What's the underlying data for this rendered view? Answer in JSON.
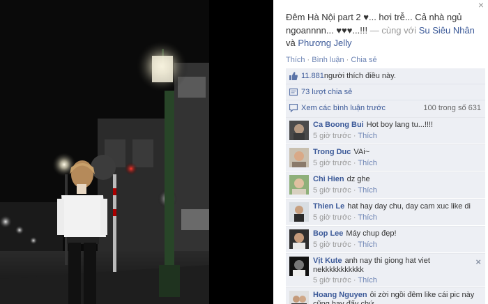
{
  "caption": {
    "text_main": "Đêm Hà Nội part 2 ♥... hơi trễ... Cả nhà ngủ ngoannnn... ♥♥♥...!!!",
    "with_text": " — cùng với ",
    "person1": "Su Siêu Nhân",
    "and_text": " và ",
    "person2": "Phương Jelly"
  },
  "actions": {
    "like": "Thích",
    "comment": "Bình luận",
    "share": "Chia sẻ"
  },
  "likes": {
    "count": "11.881",
    "text": " người thích điều này."
  },
  "shares": {
    "text": "73 lượt chia sẻ"
  },
  "view_comments": {
    "text": "Xem các bình luận trước",
    "count": "100 trong số 631"
  },
  "close_label": "×",
  "comments": [
    {
      "name": "Ca Boong Bui",
      "text": "Hot boy lang tu...!!!!",
      "time": "5 giờ trước",
      "like": "Thích"
    },
    {
      "name": "Trong Duc",
      "text": "VAi~",
      "time": "5 giờ trước",
      "like": "Thích"
    },
    {
      "name": "Chi Hien",
      "text": "dz ghe",
      "time": "5 giờ trước",
      "like": "Thích"
    },
    {
      "name": "Thien Le",
      "text": "hat hay day chu, day cam xuc like di",
      "time": "5 giờ trước",
      "like": "Thích"
    },
    {
      "name": "Bop Lee",
      "text": "Máy chup đẹp!",
      "time": "5 giờ trước",
      "like": "Thích"
    },
    {
      "name": "Vịt Kute",
      "text": "anh nay thi giong hat viet nekkkkkkkkkkk",
      "time": "5 giờ trước",
      "like": "Thích"
    },
    {
      "name": "Hoang Nguyen",
      "text": "ôi zời ngồi đêm like cái pic này cũng hay đấy chứ",
      "time": "",
      "like": ""
    }
  ],
  "colors": {
    "link": "#3b5998",
    "ufi_bg": "#edeff4",
    "muted": "#999999"
  }
}
